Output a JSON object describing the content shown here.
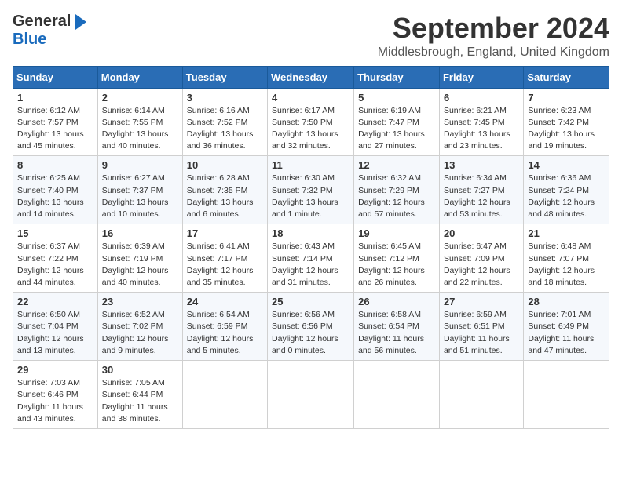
{
  "header": {
    "logo_general": "General",
    "logo_blue": "Blue",
    "month_year": "September 2024",
    "location": "Middlesbrough, England, United Kingdom"
  },
  "days": [
    "Sunday",
    "Monday",
    "Tuesday",
    "Wednesday",
    "Thursday",
    "Friday",
    "Saturday"
  ],
  "weeks": [
    [
      {
        "day": "1",
        "sunrise": "Sunrise: 6:12 AM",
        "sunset": "Sunset: 7:57 PM",
        "daylight": "Daylight: 13 hours and 45 minutes."
      },
      {
        "day": "2",
        "sunrise": "Sunrise: 6:14 AM",
        "sunset": "Sunset: 7:55 PM",
        "daylight": "Daylight: 13 hours and 40 minutes."
      },
      {
        "day": "3",
        "sunrise": "Sunrise: 6:16 AM",
        "sunset": "Sunset: 7:52 PM",
        "daylight": "Daylight: 13 hours and 36 minutes."
      },
      {
        "day": "4",
        "sunrise": "Sunrise: 6:17 AM",
        "sunset": "Sunset: 7:50 PM",
        "daylight": "Daylight: 13 hours and 32 minutes."
      },
      {
        "day": "5",
        "sunrise": "Sunrise: 6:19 AM",
        "sunset": "Sunset: 7:47 PM",
        "daylight": "Daylight: 13 hours and 27 minutes."
      },
      {
        "day": "6",
        "sunrise": "Sunrise: 6:21 AM",
        "sunset": "Sunset: 7:45 PM",
        "daylight": "Daylight: 13 hours and 23 minutes."
      },
      {
        "day": "7",
        "sunrise": "Sunrise: 6:23 AM",
        "sunset": "Sunset: 7:42 PM",
        "daylight": "Daylight: 13 hours and 19 minutes."
      }
    ],
    [
      {
        "day": "8",
        "sunrise": "Sunrise: 6:25 AM",
        "sunset": "Sunset: 7:40 PM",
        "daylight": "Daylight: 13 hours and 14 minutes."
      },
      {
        "day": "9",
        "sunrise": "Sunrise: 6:27 AM",
        "sunset": "Sunset: 7:37 PM",
        "daylight": "Daylight: 13 hours and 10 minutes."
      },
      {
        "day": "10",
        "sunrise": "Sunrise: 6:28 AM",
        "sunset": "Sunset: 7:35 PM",
        "daylight": "Daylight: 13 hours and 6 minutes."
      },
      {
        "day": "11",
        "sunrise": "Sunrise: 6:30 AM",
        "sunset": "Sunset: 7:32 PM",
        "daylight": "Daylight: 13 hours and 1 minute."
      },
      {
        "day": "12",
        "sunrise": "Sunrise: 6:32 AM",
        "sunset": "Sunset: 7:29 PM",
        "daylight": "Daylight: 12 hours and 57 minutes."
      },
      {
        "day": "13",
        "sunrise": "Sunrise: 6:34 AM",
        "sunset": "Sunset: 7:27 PM",
        "daylight": "Daylight: 12 hours and 53 minutes."
      },
      {
        "day": "14",
        "sunrise": "Sunrise: 6:36 AM",
        "sunset": "Sunset: 7:24 PM",
        "daylight": "Daylight: 12 hours and 48 minutes."
      }
    ],
    [
      {
        "day": "15",
        "sunrise": "Sunrise: 6:37 AM",
        "sunset": "Sunset: 7:22 PM",
        "daylight": "Daylight: 12 hours and 44 minutes."
      },
      {
        "day": "16",
        "sunrise": "Sunrise: 6:39 AM",
        "sunset": "Sunset: 7:19 PM",
        "daylight": "Daylight: 12 hours and 40 minutes."
      },
      {
        "day": "17",
        "sunrise": "Sunrise: 6:41 AM",
        "sunset": "Sunset: 7:17 PM",
        "daylight": "Daylight: 12 hours and 35 minutes."
      },
      {
        "day": "18",
        "sunrise": "Sunrise: 6:43 AM",
        "sunset": "Sunset: 7:14 PM",
        "daylight": "Daylight: 12 hours and 31 minutes."
      },
      {
        "day": "19",
        "sunrise": "Sunrise: 6:45 AM",
        "sunset": "Sunset: 7:12 PM",
        "daylight": "Daylight: 12 hours and 26 minutes."
      },
      {
        "day": "20",
        "sunrise": "Sunrise: 6:47 AM",
        "sunset": "Sunset: 7:09 PM",
        "daylight": "Daylight: 12 hours and 22 minutes."
      },
      {
        "day": "21",
        "sunrise": "Sunrise: 6:48 AM",
        "sunset": "Sunset: 7:07 PM",
        "daylight": "Daylight: 12 hours and 18 minutes."
      }
    ],
    [
      {
        "day": "22",
        "sunrise": "Sunrise: 6:50 AM",
        "sunset": "Sunset: 7:04 PM",
        "daylight": "Daylight: 12 hours and 13 minutes."
      },
      {
        "day": "23",
        "sunrise": "Sunrise: 6:52 AM",
        "sunset": "Sunset: 7:02 PM",
        "daylight": "Daylight: 12 hours and 9 minutes."
      },
      {
        "day": "24",
        "sunrise": "Sunrise: 6:54 AM",
        "sunset": "Sunset: 6:59 PM",
        "daylight": "Daylight: 12 hours and 5 minutes."
      },
      {
        "day": "25",
        "sunrise": "Sunrise: 6:56 AM",
        "sunset": "Sunset: 6:56 PM",
        "daylight": "Daylight: 12 hours and 0 minutes."
      },
      {
        "day": "26",
        "sunrise": "Sunrise: 6:58 AM",
        "sunset": "Sunset: 6:54 PM",
        "daylight": "Daylight: 11 hours and 56 minutes."
      },
      {
        "day": "27",
        "sunrise": "Sunrise: 6:59 AM",
        "sunset": "Sunset: 6:51 PM",
        "daylight": "Daylight: 11 hours and 51 minutes."
      },
      {
        "day": "28",
        "sunrise": "Sunrise: 7:01 AM",
        "sunset": "Sunset: 6:49 PM",
        "daylight": "Daylight: 11 hours and 47 minutes."
      }
    ],
    [
      {
        "day": "29",
        "sunrise": "Sunrise: 7:03 AM",
        "sunset": "Sunset: 6:46 PM",
        "daylight": "Daylight: 11 hours and 43 minutes."
      },
      {
        "day": "30",
        "sunrise": "Sunrise: 7:05 AM",
        "sunset": "Sunset: 6:44 PM",
        "daylight": "Daylight: 11 hours and 38 minutes."
      },
      null,
      null,
      null,
      null,
      null
    ]
  ]
}
